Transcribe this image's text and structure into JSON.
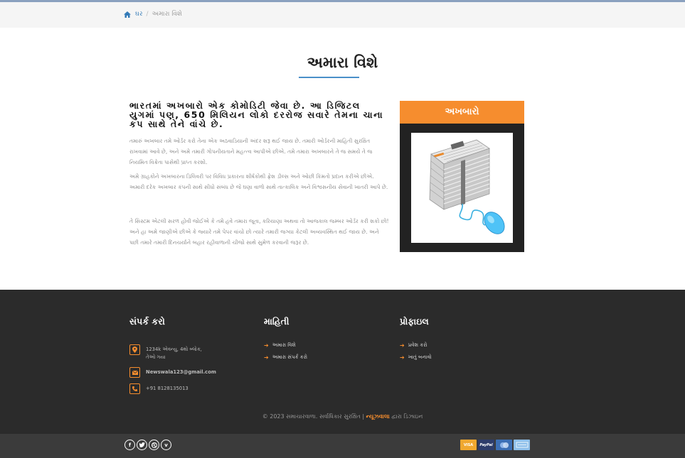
{
  "breadcrumb": {
    "home": "ઘર",
    "separator": "/",
    "current": "અમારા વિશે"
  },
  "page": {
    "title": "અમારા વિશે"
  },
  "content": {
    "lead": "ભારતમાં અખબારો એક કોમોડિટી જેવા છે. આ ડિજિટલ યુગમાં પણ, 650 મિલિયન લોકો દરરોજ સવારે તેમના ચાના કપ સાથે તેને વાંચે છે.",
    "p1": "તમારું અખબાર તમે ઓર્ડર કરો તેના એક અઠવાડિયાની અંદર શરૂ થઈ જાય છે. તમારી ઓર્ડરની માહિતી સુરક્ષિત રાખવામાં આવે છે, અને અમે તમારી ગોપનીયતાને મહત્ત્વ આપીએ છીએ. તમે તમારા અખબારને તે જ સમયે તે જ નિયમિત વિક્રેતા પાસેથી પ્રાપ્ત કરશો.",
    "p2": "અમે ગ્રાહકોને અખબારના ડિલિવરી પર વિવિધ પ્રકારના શીર્ષકોથી ફ્રેશ ડીલ્સ અને ઓછી કિંમતો પ્રદાન કરીએ છીએ. અમારી દરેક અખબાર કંપની સાથે સીધો સંબંધ છે જે ઘણા વાળો સાથે તાત્કાલિક અને વિશ્વસનીય સેવાની ખાતરી આપે છે.",
    "p3": "તે સિસ્ટમ એટલી સરળ હોવી જોઈએ કે તમે હવે તમારા જૂતા, કરિયાણા અથવા તો આજકાલ જમ્બર ઓર્ડર કરી શકો છો! અને હા અમે જાણીએ છીએ કે જ્યારે તમે પેપર વાંચો છો ત્યારે તમારી જગ્યા કેટલી અવ્યવસ્થિત થઈ જાય છે. અને પછી તમારે તમારી દિનચર્યાને બહાર રહીવાળાની ચીજો સાથે સુમેળ કરવાની જરૂર છે."
  },
  "sidebar": {
    "heading": "અખબારો",
    "image_label": "NEWS"
  },
  "footer": {
    "contact": {
      "title": "સંપર્ક કરો",
      "address_line1": "1234k એવન્યુ, 4થો બ્લોક,",
      "address_line2": "તેઓ ગયા",
      "email": "Newswala123@gmail.com",
      "phone": "+91 8128135013"
    },
    "info": {
      "title": "માહિતી",
      "links": [
        "અમારા વિશે",
        "અમારા સંપર્ક કરો"
      ]
    },
    "profile": {
      "title": "પ્રોફાઇલ",
      "links": [
        "પ્રવેશ કરો",
        "ખાતું બનાવો"
      ]
    },
    "copyright_prefix": "© 2023 સમાચારવાળા. સર્વાધિકાર સુરક્ષિત |",
    "copyright_brand": "ન્યૂઝવાલા",
    "copyright_suffix": "દ્વારા ડિઝાઇન"
  },
  "social": {
    "icons": [
      "facebook-icon",
      "twitter-icon",
      "dribbble-icon",
      "vimeo-icon"
    ]
  },
  "payments": {
    "visa": "VISA",
    "paypal": "PayPal",
    "mastercard": "",
    "amex": ""
  },
  "colors": {
    "accent": "#f68d2e",
    "footer_bg": "#2b2b2b",
    "link_blue": "#337ab7",
    "title_rule": "#4a90c9"
  }
}
